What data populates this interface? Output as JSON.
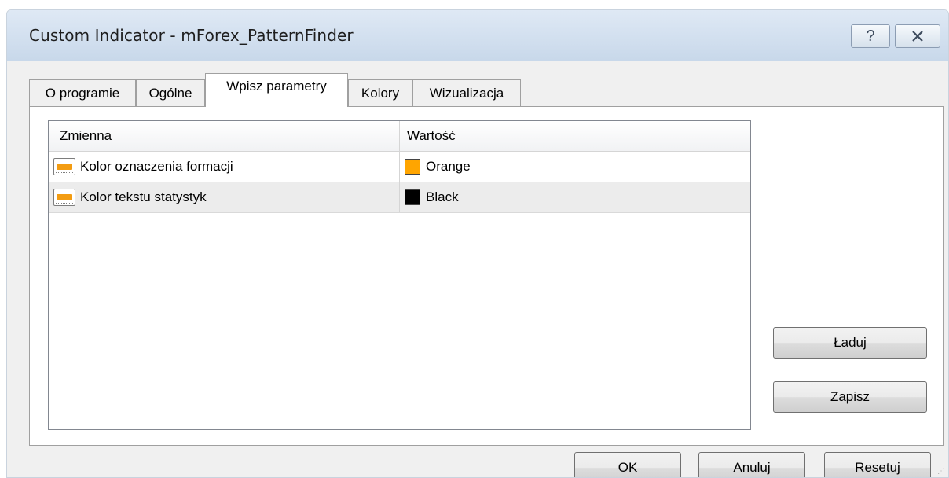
{
  "window": {
    "title": "Custom Indicator - mForex_PatternFinder",
    "help_glyph": "?",
    "close_glyph": "✕"
  },
  "tabs": [
    {
      "label": "O programie"
    },
    {
      "label": "Ogólne"
    },
    {
      "label": "Wpisz parametry"
    },
    {
      "label": "Kolory"
    },
    {
      "label": "Wizualizacja"
    }
  ],
  "active_tab": "Wpisz parametry",
  "grid": {
    "columns": [
      "Zmienna",
      "Wartość"
    ],
    "rows": [
      {
        "name": "Kolor oznaczenia formacji",
        "value": "Orange",
        "color": "#FFA500",
        "icon": "parameter-icon"
      },
      {
        "name": "Kolor tekstu statystyk",
        "value": "Black",
        "color": "#000000",
        "icon": "parameter-icon"
      }
    ]
  },
  "side_buttons": {
    "load": "Ładuj",
    "save": "Zapisz"
  },
  "footer_buttons": {
    "ok": "OK",
    "cancel": "Anuluj",
    "reset": "Resetuj"
  }
}
